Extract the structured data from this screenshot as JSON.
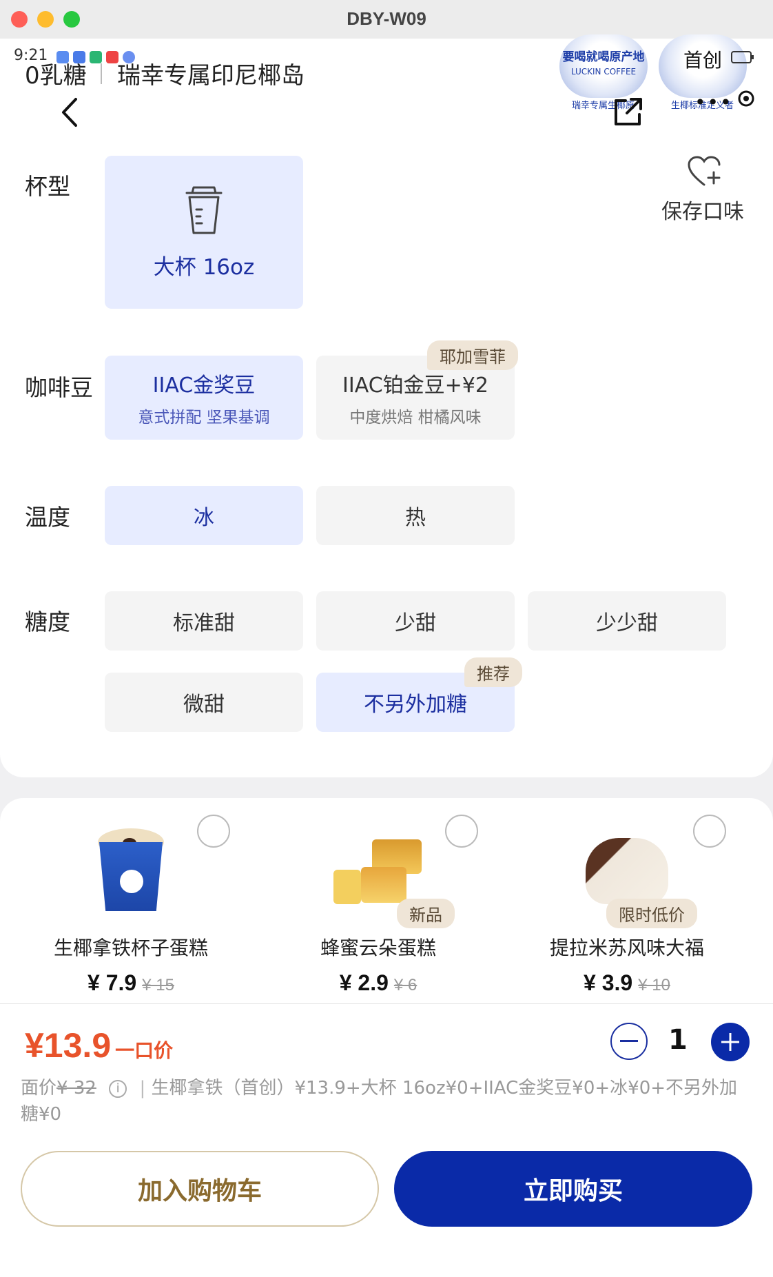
{
  "window": {
    "title": "DBY-W09"
  },
  "status_bar": {
    "time": "9:21"
  },
  "header": {
    "subtitle_left": "0乳糖",
    "subtitle_right": "瑞幸专属印尼椰岛",
    "badge1_lines": [
      "要喝就喝原产地",
      "LUCKIN COFFEE"
    ],
    "badge1_caption": "瑞幸专属生椰原",
    "badge2_top": "首创",
    "badge2_caption": "生椰标准定义者"
  },
  "save_flavor": {
    "label": "保存口味"
  },
  "cup": {
    "label": "杯型",
    "options": [
      {
        "label": "大杯 16oz",
        "selected": true
      }
    ]
  },
  "beans": {
    "label": "咖啡豆",
    "options": [
      {
        "label": "IIAC金奖豆",
        "sub": "意式拼配 坚果基调",
        "selected": true
      },
      {
        "label": "IIAC铂金豆+¥2",
        "sub": "中度烘焙 柑橘风味",
        "tag": "耶加雪菲",
        "selected": false
      }
    ]
  },
  "temperature": {
    "label": "温度",
    "options": [
      {
        "label": "冰",
        "selected": true
      },
      {
        "label": "热",
        "selected": false
      }
    ]
  },
  "sweetness": {
    "label": "糖度",
    "options": [
      {
        "label": "标准甜",
        "selected": false
      },
      {
        "label": "少甜",
        "selected": false
      },
      {
        "label": "少少甜",
        "selected": false
      },
      {
        "label": "微甜",
        "selected": false
      },
      {
        "label": "不另外加糖",
        "tag": "推荐",
        "selected": true
      }
    ]
  },
  "addons": [
    {
      "name": "生椰拿铁杯子蛋糕",
      "price": "¥ 7.9",
      "old_price": "¥ 15",
      "tag": ""
    },
    {
      "name": "蜂蜜云朵蛋糕",
      "price": "¥ 2.9",
      "old_price": "¥ 6",
      "tag": "新品"
    },
    {
      "name": "提拉米苏风味大福",
      "price": "¥ 3.9",
      "old_price": "¥ 10",
      "tag": "限时低价"
    }
  ],
  "checkout": {
    "price": "¥13.9",
    "price_suffix": "一口价",
    "quantity": "1",
    "face_value_label": "面价",
    "face_value": "¥ 32",
    "breakdown": "生椰拿铁（首创）¥13.9+大杯 16oz¥0+IIAC金奖豆¥0+冰¥0+不另外加糖¥0",
    "add_to_cart": "加入购物车",
    "buy_now": "立即购买"
  },
  "colors": {
    "accent": "#0a2aa8",
    "selected_bg": "#e7ecff",
    "price": "#e8532b",
    "cart_text": "#8a6a2e"
  }
}
